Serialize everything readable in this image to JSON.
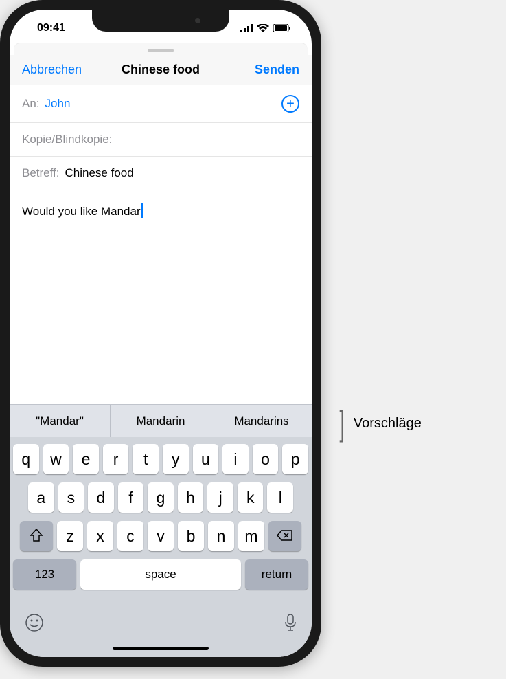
{
  "status_bar": {
    "time": "09:41"
  },
  "sheet_nav": {
    "cancel": "Abbrechen",
    "title": "Chinese food",
    "send": "Senden"
  },
  "compose": {
    "to_label": "An:",
    "to_value": "John",
    "cc_label": "Kopie/Blindkopie:",
    "cc_value": "",
    "subject_label": "Betreff:",
    "subject_value": "Chinese food",
    "body": "Would you like Mandar"
  },
  "suggestions": [
    "\"Mandar\"",
    "Mandarin",
    "Mandarins"
  ],
  "keyboard": {
    "row1": [
      "q",
      "w",
      "e",
      "r",
      "t",
      "y",
      "u",
      "i",
      "o",
      "p"
    ],
    "row2": [
      "a",
      "s",
      "d",
      "f",
      "g",
      "h",
      "j",
      "k",
      "l"
    ],
    "row3": [
      "z",
      "x",
      "c",
      "v",
      "b",
      "n",
      "m"
    ],
    "num_key": "123",
    "space_key": "space",
    "return_key": "return"
  },
  "annotation": {
    "suggestions_label": "Vorschläge"
  }
}
